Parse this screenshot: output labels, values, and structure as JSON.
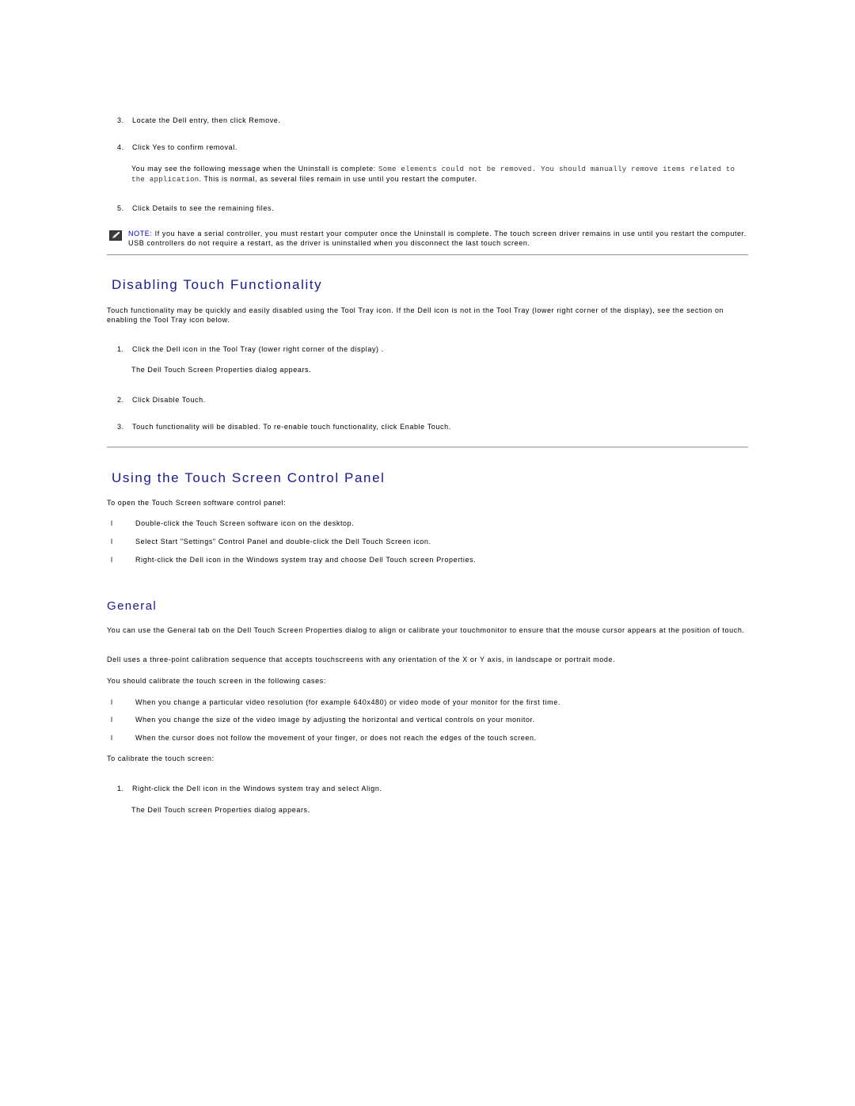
{
  "uninstall": {
    "steps": [
      {
        "num": "3.",
        "text": "Locate the Dell entry, then click Remove."
      },
      {
        "num": "4.",
        "text": "Click Yes to confirm removal."
      }
    ],
    "message_intro": "You may see the following message when the Uninstall is complete: ",
    "message_code": "Some elements could not be removed. You should manually remove items related to the application",
    "message_outro": ". This is normal, as several files remain in use until you restart the computer.",
    "step5": {
      "num": "5.",
      "text": "Click Details to see the remaining files."
    },
    "note": {
      "icon": "pencil-note-icon",
      "label": "NOTE:",
      "text": " If you have a serial controller, you must restart your computer once the Uninstall is complete. The touch screen driver remains in use until you restart the computer. USB controllers do not require a restart, as the driver is uninstalled when you disconnect the last touch screen."
    }
  },
  "disabling": {
    "heading": "Disabling Touch Functionality",
    "intro": "Touch functionality may be quickly and easily disabled using the Tool Tray icon. If the Dell icon is not in the Tool Tray (lower right corner of the display), see the section on enabling the Tool Tray icon below.",
    "steps": [
      {
        "num": "1.",
        "text": "Click the Dell icon in the Tool Tray (lower right corner of the display) ."
      },
      {
        "num": "2.",
        "text": "Click Disable Touch."
      },
      {
        "num": "3.",
        "text": "Touch functionality will be disabled. To re-enable touch functionality, click Enable Touch."
      }
    ],
    "step1_result": "The Dell Touch Screen Properties dialog appears."
  },
  "control_panel": {
    "heading": "Using the Touch Screen Control Panel",
    "intro": "To open the Touch Screen software control panel:",
    "bullet_mark": "l",
    "bullets": [
      "Double-click the Touch Screen software icon on the desktop.",
      "Select Start \"Settings\" Control Panel and double-click the Dell Touch Screen icon.",
      "Right-click the Dell icon in the Windows system tray and choose Dell Touch screen Properties."
    ]
  },
  "general": {
    "heading": "General",
    "para1": "You can use the General tab on the Dell Touch Screen Properties dialog to align or calibrate your touchmonitor to ensure that the mouse cursor appears at the position of touch.",
    "para2": "Dell uses a three-point calibration sequence that accepts touchscreens with any orientation of the X or Y axis, in landscape or portrait mode.",
    "para3": "You should calibrate the touch screen in the following cases:",
    "bullet_mark": "l",
    "bullets": [
      "When you change a particular video resolution (for example 640x480) or video mode of your monitor for the first time.",
      "When you change the size of the video image by adjusting the horizontal and vertical controls on your monitor.",
      "When the cursor does not follow the movement of your finger, or does not reach the edges of the touch screen."
    ],
    "calibrate_intro": "To calibrate the touch screen:",
    "step": {
      "num": "1.",
      "text": "Right-click the Dell icon in the Windows system tray and select Align."
    },
    "step_result": "The Dell Touch screen Properties dialog appears."
  }
}
